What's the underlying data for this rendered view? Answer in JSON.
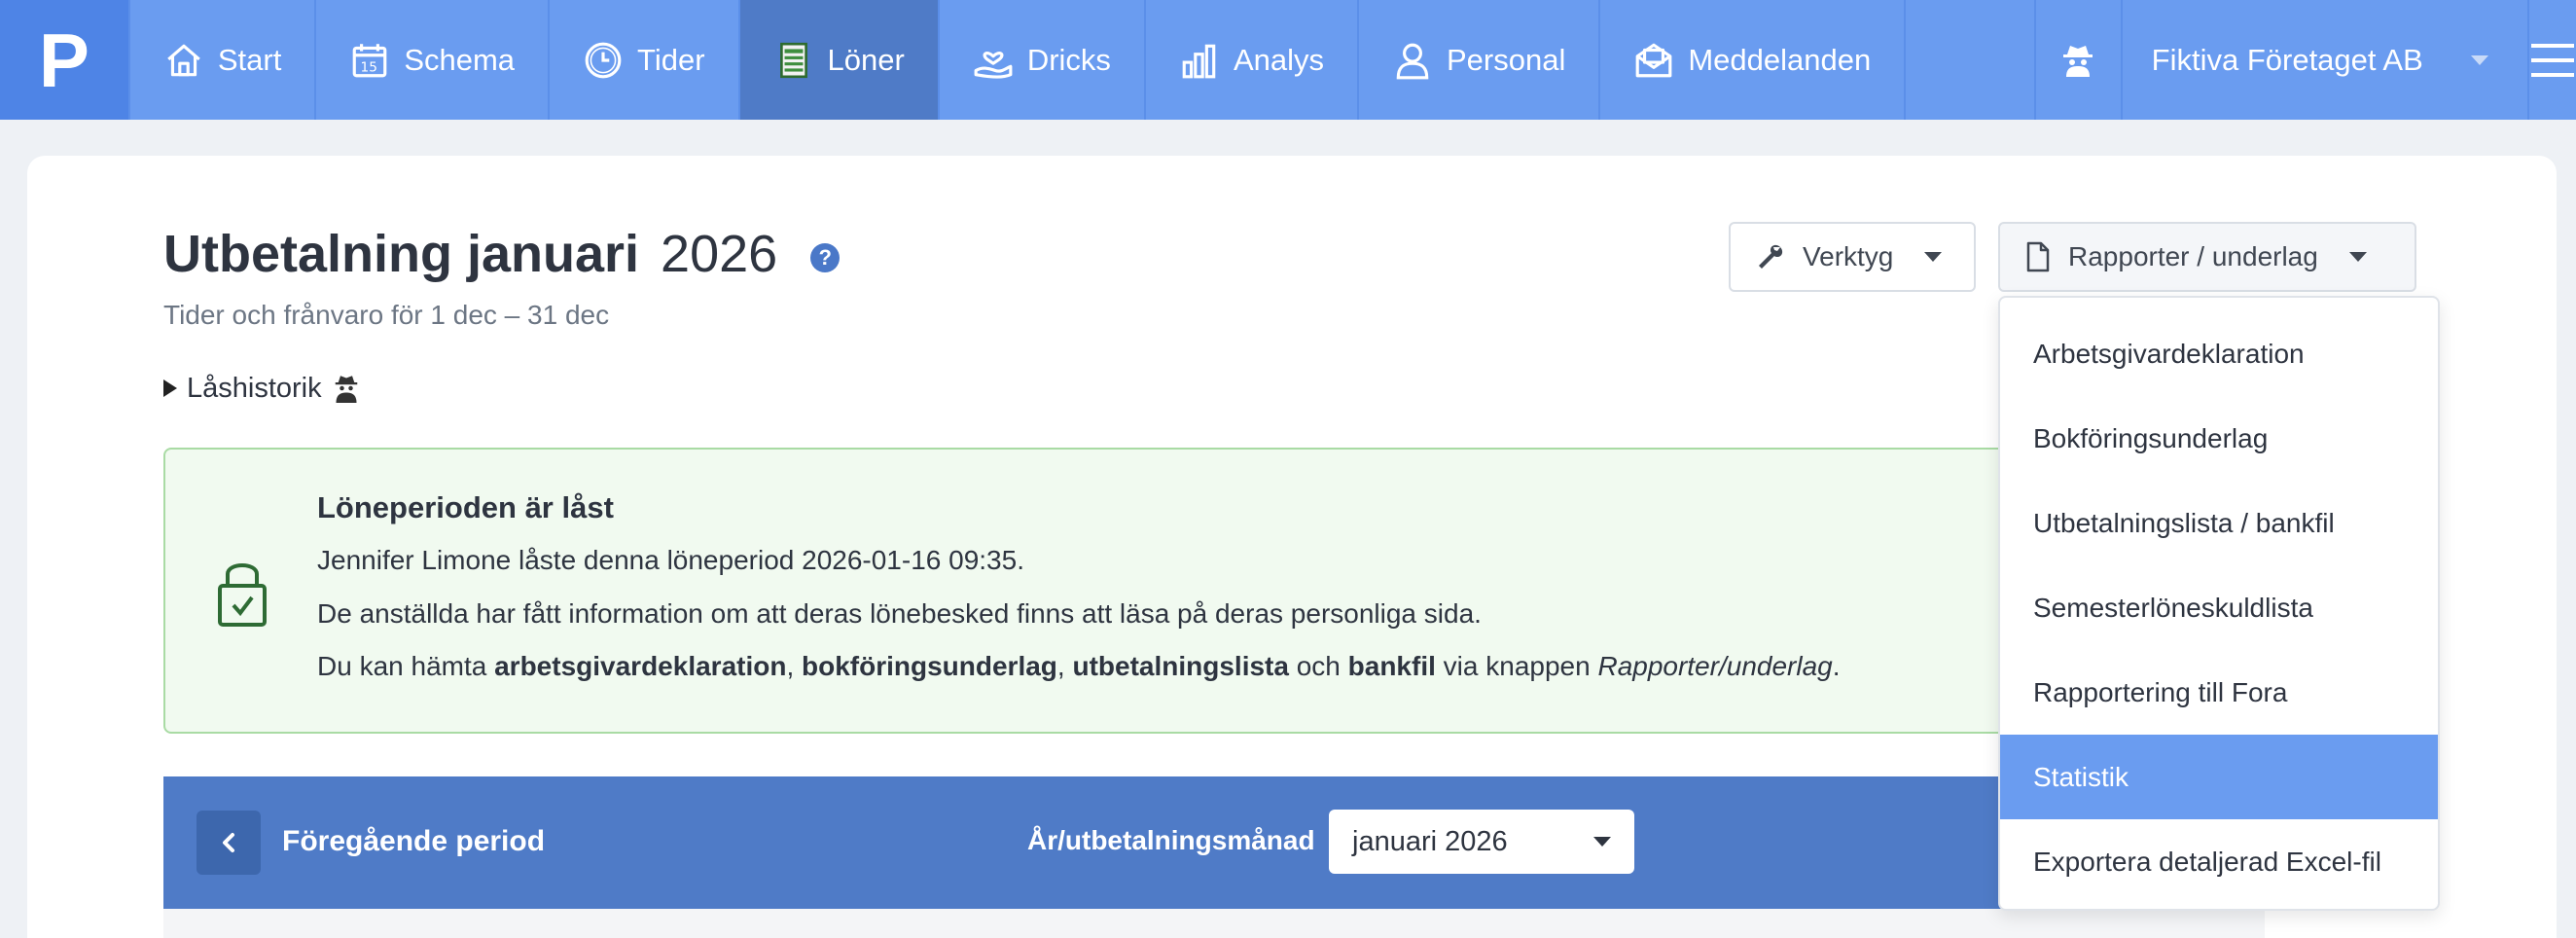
{
  "nav": {
    "logo": "P",
    "items": [
      {
        "label": "Start",
        "icon": "house-icon",
        "active": false
      },
      {
        "label": "Schema",
        "icon": "calendar-icon",
        "active": false
      },
      {
        "label": "Tider",
        "icon": "clock-icon",
        "active": false
      },
      {
        "label": "Löner",
        "icon": "document-icon",
        "active": true
      },
      {
        "label": "Dricks",
        "icon": "hand-heart-icon",
        "active": false
      },
      {
        "label": "Analys",
        "icon": "bar-chart-icon",
        "active": false
      },
      {
        "label": "Personal",
        "icon": "person-icon",
        "active": false
      },
      {
        "label": "Meddelanden",
        "icon": "mail-icon",
        "active": false
      }
    ],
    "company": "Fiktiva Företaget AB"
  },
  "page": {
    "title": "Utbetalning januari",
    "year": "2026",
    "help": "?",
    "subtitle": "Tider och frånvaro för 1 dec – 31 dec",
    "lock_history": "Låshistorik"
  },
  "toolbar": {
    "tools": "Verktyg",
    "reports": "Rapporter / underlag"
  },
  "locked": {
    "title": "Löneperioden är låst",
    "line1": "Jennifer Limone låste denna löneperiod 2026-01-16 09:35.",
    "line2": "De anställda har fått information om att deras lönebesked finns att läsa på deras personliga sida.",
    "line3_prefix": "Du kan hämta ",
    "line3_b1": "arbetsgivardeklaration",
    "sep1": ", ",
    "line3_b2": "bokföringsunderlag",
    "sep2": ", ",
    "line3_b3": "utbetalningslista",
    "line3_och": " och ",
    "line3_b4": "bankfil",
    "line3_via": " via knappen ",
    "line3_i": "Rapporter/underlag",
    "line3_end": "."
  },
  "period": {
    "previous": "Föregående period",
    "month_label": "År/utbetalningsmånad",
    "month_value": "januari 2026"
  },
  "reports_menu": {
    "items": [
      {
        "label": "Arbetsgivardeklaration"
      },
      {
        "label": "Bokföringsunderlag"
      },
      {
        "label": "Utbetalningslista / bankfil"
      },
      {
        "label": "Semesterlöneskuldlista"
      },
      {
        "label": "Rapportering till Fora"
      },
      {
        "label": "Statistik",
        "highlighted": true
      },
      {
        "label": "Exportera detaljerad Excel-fil"
      }
    ]
  },
  "colors": {
    "nav_bg": "#6a9cf0",
    "nav_active": "#4f7bc7",
    "period_bar": "#4f7bc7",
    "success_bg": "#f1faf0",
    "success_border": "#a9dba4",
    "menu_highlight": "#6a9cf0"
  }
}
